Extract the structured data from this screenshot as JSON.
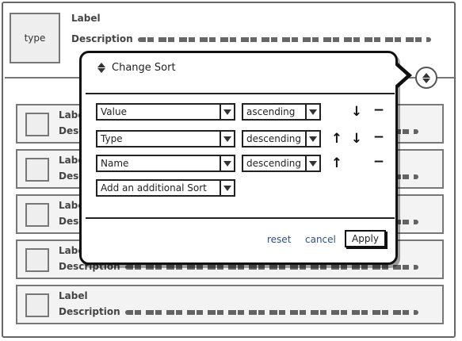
{
  "header_item": {
    "thumb_text": "type",
    "label": "Label",
    "description": "Description"
  },
  "list_items": [
    {
      "label": "Label",
      "description": "Description"
    },
    {
      "label": "Label",
      "description": "Description"
    },
    {
      "label": "Label",
      "description": "Description"
    },
    {
      "label": "Label",
      "description": "Description"
    },
    {
      "label": "Label",
      "description": "Description"
    }
  ],
  "popover": {
    "title": "Change Sort",
    "sorts": [
      {
        "field": "Value",
        "order": "ascending",
        "can_move_up": false,
        "can_move_down": true
      },
      {
        "field": "Type",
        "order": "descending",
        "can_move_up": true,
        "can_move_down": true
      },
      {
        "field": "Name",
        "order": "descending",
        "can_move_up": true,
        "can_move_down": false
      }
    ],
    "add_sort_label": "Add an additional Sort",
    "reset_label": "reset",
    "cancel_label": "cancel",
    "apply_label": "Apply"
  },
  "icons": {
    "up": "arrow-up",
    "down": "arrow-down",
    "remove": "minus",
    "sort": "sort-toggle"
  },
  "colors": {
    "link": "#2b4f86",
    "border": "#111111"
  }
}
